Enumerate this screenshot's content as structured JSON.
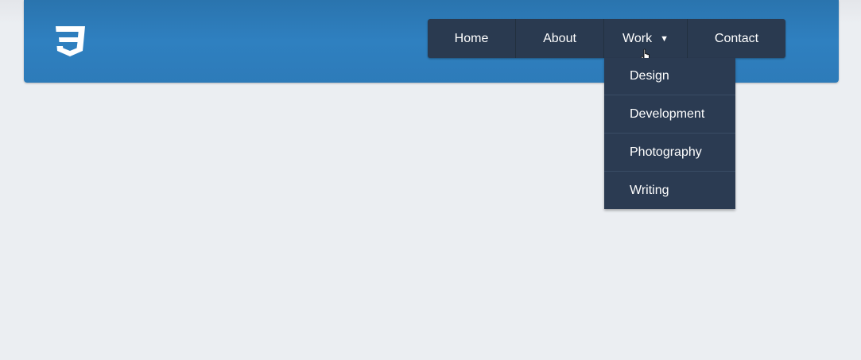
{
  "header": {
    "logo_icon": "css3-shield-icon",
    "background_color": "#2f80c0"
  },
  "nav": {
    "items": [
      {
        "label": "Home"
      },
      {
        "label": "About"
      },
      {
        "label": "Work",
        "caret": "▼"
      },
      {
        "label": "Contact"
      }
    ],
    "background_color": "#2a3a50"
  },
  "dropdown": {
    "items": [
      {
        "label": "Design"
      },
      {
        "label": "Development"
      },
      {
        "label": "Photography"
      },
      {
        "label": "Writing"
      }
    ]
  }
}
